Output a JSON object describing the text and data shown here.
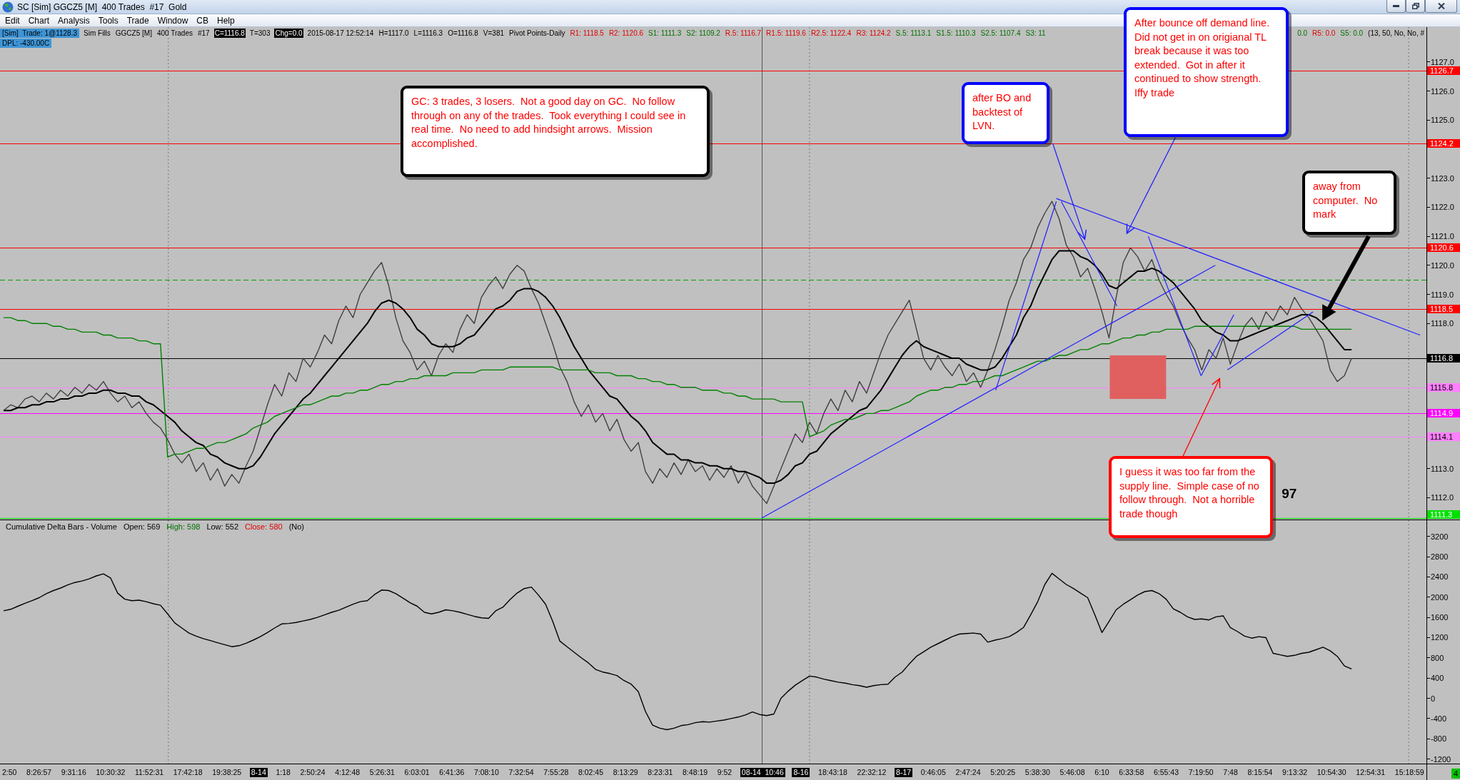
{
  "window": {
    "title": "SC [Sim] GGCZ5 [M]  400 Trades  #17  Gold"
  },
  "menu": [
    "Edit",
    "Chart",
    "Analysis",
    "Tools",
    "Trade",
    "Window",
    "CB",
    "Help"
  ],
  "price_pane": {
    "info_left": [
      {
        "text": "[Sim]  Trade: 1@1128.3",
        "kind": "highlight"
      },
      {
        "text": "Sim Fills",
        "kind": "plain"
      },
      {
        "text": "GGCZ5 [M]",
        "kind": "plain"
      },
      {
        "text": "400 Trades",
        "kind": "plain"
      },
      {
        "text": "#17",
        "kind": "plain"
      },
      {
        "text": "C=1116.8",
        "kind": "inverse"
      },
      {
        "text": "T=303",
        "kind": "plain"
      },
      {
        "text": "Chg=0.0",
        "kind": "inverse"
      },
      {
        "text": "2015-08-17 12:52:14",
        "kind": "plain"
      },
      {
        "text": "H=1117.0",
        "kind": "plain"
      },
      {
        "text": "L=1116.3",
        "kind": "plain"
      },
      {
        "text": "O=1116.8",
        "kind": "plain"
      },
      {
        "text": "V=381",
        "kind": "plain"
      },
      {
        "text": "Pivot Points-Daily",
        "kind": "plain"
      },
      {
        "text": "R1: 1118.5",
        "kind": "resistance"
      },
      {
        "text": "R2: 1120.6",
        "kind": "resistance"
      },
      {
        "text": "S1: 1111.3",
        "kind": "support"
      },
      {
        "text": "S2: 1109.2",
        "kind": "support"
      },
      {
        "text": "R.5: 1116.7",
        "kind": "resistance"
      },
      {
        "text": "R1.5: 1119.6",
        "kind": "resistance"
      },
      {
        "text": "R2.5: 1122.4",
        "kind": "resistance"
      },
      {
        "text": "R3: 1124.2",
        "kind": "resistance"
      },
      {
        "text": "S.5: 1113.1",
        "kind": "support"
      },
      {
        "text": "S1.5: 1110.3",
        "kind": "support"
      },
      {
        "text": "S2.5: 1107.4",
        "kind": "support"
      },
      {
        "text": "S3: 11",
        "kind": "support"
      }
    ],
    "info_right": [
      {
        "text": "0.0",
        "kind": "support"
      },
      {
        "text": "R5: 0.0",
        "kind": "resistance"
      },
      {
        "text": "S5: 0.0",
        "kind": "support"
      },
      {
        "text": "(13, 50, No, No, #",
        "kind": "plain"
      }
    ],
    "info_second_row": [
      {
        "text": "DPL: -430.00C",
        "kind": "highlight"
      }
    ],
    "chart_data": {
      "type": "line",
      "ylim": [
        1111.25,
        1128.2
      ],
      "yticks": [
        {
          "value": 1127,
          "label": "1127.0"
        },
        {
          "value": 1126,
          "label": "1126.0"
        },
        {
          "value": 1125,
          "label": "1125.0"
        },
        {
          "value": 1123,
          "label": "1123.0"
        },
        {
          "value": 1122,
          "label": "1122.0"
        },
        {
          "value": 1121,
          "label": "1121.0"
        },
        {
          "value": 1120,
          "label": "1120.0"
        },
        {
          "value": 1119,
          "label": "1119.0"
        },
        {
          "value": 1118,
          "label": "1118.0"
        },
        {
          "value": 1113,
          "label": "1113.0"
        },
        {
          "value": 1112,
          "label": "1112.0"
        }
      ],
      "series": [
        {
          "color": "#404040",
          "values": [
            1115.0,
            1115.2,
            1115.1,
            1115.4,
            1115.5,
            1115.3,
            1115.6,
            1115.4,
            1115.7,
            1115.5,
            1115.8,
            1115.6,
            1115.9,
            1115.7,
            1116.0,
            1115.6,
            1115.3,
            1115.5,
            1115.1,
            1115.3,
            1114.9,
            1114.6,
            1114.4,
            1114.0,
            1113.5,
            1113.2,
            1113.5,
            1112.9,
            1113.2,
            1112.6,
            1113.0,
            1112.4,
            1112.8,
            1112.5,
            1113.1,
            1113.6,
            1114.4,
            1115.2,
            1115.9,
            1115.5,
            1116.3,
            1116.0,
            1116.8,
            1116.5,
            1117.0,
            1117.6,
            1117.3,
            1118.1,
            1118.6,
            1118.2,
            1119.0,
            1119.4,
            1119.8,
            1120.1,
            1119.3,
            1118.2,
            1117.4,
            1117.0,
            1116.4,
            1116.7,
            1116.2,
            1116.9,
            1117.3,
            1117.0,
            1117.8,
            1118.3,
            1118.0,
            1118.9,
            1119.3,
            1119.6,
            1119.2,
            1119.7,
            1120.0,
            1119.8,
            1119.2,
            1118.7,
            1118.0,
            1117.3,
            1116.5,
            1116.0,
            1115.3,
            1114.8,
            1115.2,
            1114.6,
            1114.9,
            1114.3,
            1114.7,
            1114.0,
            1113.6,
            1113.9,
            1112.9,
            1112.5,
            1113.0,
            1112.7,
            1113.2,
            1112.8,
            1113.3,
            1112.9,
            1113.1,
            1112.6,
            1113.0,
            1112.7,
            1113.1,
            1112.5,
            1112.9,
            1112.4,
            1112.1,
            1111.8,
            1112.4,
            1113.0,
            1113.6,
            1114.2,
            1113.9,
            1114.6,
            1114.2,
            1114.9,
            1115.4,
            1115.0,
            1115.7,
            1115.3,
            1116.0,
            1115.6,
            1116.3,
            1117.0,
            1117.6,
            1118.0,
            1118.4,
            1118.8,
            1117.8,
            1116.8,
            1116.4,
            1116.9,
            1116.5,
            1116.2,
            1116.6,
            1116.0,
            1116.3,
            1115.8,
            1116.4,
            1117.1,
            1117.9,
            1118.8,
            1119.4,
            1120.2,
            1120.6,
            1121.3,
            1121.8,
            1122.2,
            1121.6,
            1120.7,
            1120.3,
            1119.6,
            1119.9,
            1119.2,
            1118.4,
            1117.5,
            1118.9,
            1120.1,
            1120.6,
            1120.3,
            1119.8,
            1120.2,
            1119.5,
            1119.0,
            1118.6,
            1118.0,
            1117.5,
            1117.1,
            1116.4,
            1117.1,
            1116.8,
            1117.5,
            1116.6,
            1117.3,
            1117.9,
            1118.2,
            1117.8,
            1118.4,
            1118.1,
            1118.6,
            1118.3,
            1118.9,
            1118.5,
            1118.2,
            1117.8,
            1117.4,
            1116.4,
            1116.0,
            1116.2,
            1116.8,
            null,
            null,
            null,
            null,
            null,
            null,
            null,
            null,
            null,
            null
          ]
        },
        {
          "color": "#000000",
          "values": [
            1115.0,
            1115.0,
            1115.1,
            1115.1,
            1115.2,
            1115.2,
            1115.3,
            1115.3,
            1115.4,
            1115.4,
            1115.5,
            1115.5,
            1115.6,
            1115.6,
            1115.7,
            1115.7,
            1115.6,
            1115.6,
            1115.5,
            1115.5,
            1115.3,
            1115.2,
            1115.0,
            1114.8,
            1114.6,
            1114.3,
            1114.1,
            1113.9,
            1113.8,
            1113.5,
            1113.4,
            1113.2,
            1113.1,
            1113.0,
            1113.0,
            1113.1,
            1113.4,
            1113.8,
            1114.2,
            1114.5,
            1114.8,
            1115.1,
            1115.4,
            1115.6,
            1115.9,
            1116.2,
            1116.5,
            1116.8,
            1117.1,
            1117.4,
            1117.7,
            1118.0,
            1118.4,
            1118.7,
            1118.8,
            1118.7,
            1118.5,
            1118.2,
            1117.8,
            1117.6,
            1117.3,
            1117.2,
            1117.2,
            1117.2,
            1117.3,
            1117.5,
            1117.6,
            1117.9,
            1118.2,
            1118.5,
            1118.6,
            1118.8,
            1119.1,
            1119.2,
            1119.2,
            1119.1,
            1118.9,
            1118.6,
            1118.2,
            1117.7,
            1117.2,
            1116.8,
            1116.4,
            1116.1,
            1115.8,
            1115.5,
            1115.4,
            1115.1,
            1114.8,
            1114.6,
            1114.3,
            1113.9,
            1113.7,
            1113.5,
            1113.5,
            1113.3,
            1113.3,
            1113.2,
            1113.2,
            1113.1,
            1113.1,
            1113.0,
            1113.0,
            1112.9,
            1112.9,
            1112.8,
            1112.7,
            1112.5,
            1112.5,
            1112.6,
            1112.8,
            1113.1,
            1113.2,
            1113.5,
            1113.6,
            1113.9,
            1114.2,
            1114.4,
            1114.6,
            1114.8,
            1115.0,
            1115.1,
            1115.4,
            1115.7,
            1116.1,
            1116.5,
            1116.9,
            1117.2,
            1117.4,
            1117.2,
            1117.1,
            1117.0,
            1116.9,
            1116.8,
            1116.8,
            1116.6,
            1116.5,
            1116.4,
            1116.4,
            1116.5,
            1116.8,
            1117.2,
            1117.6,
            1118.2,
            1118.6,
            1119.2,
            1119.7,
            1120.2,
            1120.5,
            1120.5,
            1120.5,
            1120.3,
            1120.2,
            1120.0,
            1119.7,
            1119.3,
            1119.2,
            1119.4,
            1119.6,
            1119.8,
            1119.8,
            1119.9,
            1119.8,
            1119.6,
            1119.4,
            1119.1,
            1118.8,
            1118.5,
            1118.1,
            1117.9,
            1117.7,
            1117.6,
            1117.4,
            1117.4,
            1117.5,
            1117.6,
            1117.7,
            1117.8,
            1117.9,
            1118.0,
            1118.1,
            1118.2,
            1118.3,
            1118.3,
            1118.2,
            1118.0,
            1117.7,
            1117.4,
            1117.1,
            1117.1,
            null,
            null,
            null,
            null,
            null,
            null,
            null,
            null,
            null,
            null
          ]
        },
        {
          "color": "#008000",
          "values": [
            1118.2,
            1118.2,
            1118.1,
            1118.1,
            1118.0,
            1118.0,
            1118.0,
            1117.9,
            1117.9,
            1117.8,
            1117.8,
            1117.7,
            1117.7,
            1117.7,
            1117.6,
            1117.6,
            1117.5,
            1117.5,
            1117.5,
            1117.4,
            1117.4,
            1117.3,
            1117.3,
            1113.4,
            1113.5,
            1113.5,
            1113.6,
            1113.7,
            1113.7,
            1113.8,
            1113.9,
            1113.9,
            1114.0,
            1114.1,
            1114.2,
            1114.4,
            1114.5,
            1114.6,
            1114.8,
            1114.9,
            1115.0,
            1115.1,
            1115.2,
            1115.2,
            1115.3,
            1115.4,
            1115.5,
            1115.5,
            1115.6,
            1115.6,
            1115.7,
            1115.7,
            1115.8,
            1115.9,
            1115.9,
            1116.0,
            1116.0,
            1116.1,
            1116.1,
            1116.2,
            1116.2,
            1116.2,
            1116.2,
            1116.3,
            1116.3,
            1116.3,
            1116.3,
            1116.4,
            1116.4,
            1116.4,
            1116.4,
            1116.5,
            1116.5,
            1116.5,
            1116.5,
            1116.5,
            1116.5,
            1116.5,
            1116.4,
            1116.4,
            1116.4,
            1116.4,
            1116.4,
            1116.3,
            1116.3,
            1116.3,
            1116.2,
            1116.2,
            1116.2,
            1116.1,
            1116.1,
            1116.0,
            1116.0,
            1115.9,
            1115.9,
            1115.8,
            1115.8,
            1115.8,
            1115.7,
            1115.7,
            1115.7,
            1115.6,
            1115.6,
            1115.5,
            1115.5,
            1115.4,
            1115.4,
            1115.4,
            1115.4,
            1115.3,
            1115.3,
            1115.3,
            1115.3,
            1114.1,
            1114.2,
            1114.3,
            1114.5,
            1114.6,
            1114.7,
            1114.7,
            1114.8,
            1114.9,
            1114.9,
            1115.0,
            1115.0,
            1115.1,
            1115.2,
            1115.3,
            1115.5,
            1115.6,
            1115.7,
            1115.7,
            1115.8,
            1115.8,
            1115.9,
            1115.9,
            1116.0,
            1116.0,
            1116.1,
            1116.2,
            1116.2,
            1116.3,
            1116.4,
            1116.5,
            1116.6,
            1116.7,
            1116.7,
            1116.8,
            1116.9,
            1116.9,
            1117.0,
            1117.1,
            1117.1,
            1117.2,
            1117.3,
            1117.3,
            1117.4,
            1117.5,
            1117.5,
            1117.6,
            1117.6,
            1117.7,
            1117.7,
            1117.8,
            1117.8,
            1117.8,
            1117.8,
            1117.9,
            1117.9,
            1117.9,
            1117.9,
            1117.9,
            1117.9,
            1117.9,
            1117.9,
            1117.9,
            1117.9,
            1117.9,
            1117.9,
            1117.9,
            1117.9,
            1117.9,
            1117.8,
            1117.8,
            1117.8,
            1117.8,
            1117.8,
            1117.8,
            1117.8,
            1117.8,
            null,
            null,
            null,
            null,
            null,
            null,
            null,
            null,
            null,
            null
          ]
        }
      ],
      "ref_lines": [
        {
          "axis": "y",
          "value": 1126.7,
          "label": "1126.7",
          "color": "#ff0000"
        },
        {
          "axis": "y",
          "value": 1124.2,
          "label": "1124.2",
          "color": "#ff0000"
        },
        {
          "axis": "y",
          "value": 1120.6,
          "label": "1120.6",
          "color": "#ff0000"
        },
        {
          "axis": "y",
          "value": 1119.5,
          "color": "#00a000"
        },
        {
          "axis": "y",
          "value": 1118.5,
          "label": "1118.5",
          "color": "#ff0000"
        },
        {
          "axis": "y",
          "value": 1116.8,
          "label": "1116.8",
          "color": "#000000"
        },
        {
          "axis": "y",
          "value": 1115.8,
          "label": "1115.8",
          "color": "#ff80ff"
        },
        {
          "axis": "y",
          "value": 1114.9,
          "label": "1114.9",
          "color": "#ff00ff"
        },
        {
          "axis": "y",
          "value": 1114.1,
          "label": "1114.1",
          "color": "#ff80ff"
        },
        {
          "axis": "y",
          "value": 1111.3,
          "label": "1111.3",
          "color": "#00e000"
        }
      ],
      "annotations": [
        "97"
      ]
    }
  },
  "delta_pane": {
    "legend": [
      {
        "text": "Cumulative Delta Bars - Volume",
        "kind": "plain"
      },
      {
        "text": "Open: 569",
        "kind": "plain"
      },
      {
        "text": "High: 598",
        "kind": "high"
      },
      {
        "text": "Low: 552",
        "kind": "plain"
      },
      {
        "text": "Close: 580",
        "kind": "close"
      },
      {
        "text": "(No)",
        "kind": "plain"
      }
    ],
    "chart_data": {
      "type": "line",
      "ylim": [
        -1290,
        3520
      ],
      "yticks": [
        3200,
        2800,
        2400,
        2000,
        1600,
        1200,
        800,
        400,
        0,
        -400,
        -800,
        -1200
      ],
      "series": [
        {
          "color": "#000000",
          "values": [
            1730,
            1760,
            1820,
            1880,
            1930,
            1990,
            2070,
            2130,
            2180,
            2240,
            2290,
            2320,
            2360,
            2420,
            2460,
            2380,
            2080,
            1960,
            1930,
            1940,
            1910,
            1870,
            1840,
            1670,
            1490,
            1390,
            1290,
            1230,
            1180,
            1140,
            1100,
            1060,
            1020,
            1040,
            1090,
            1150,
            1220,
            1300,
            1390,
            1470,
            1480,
            1500,
            1530,
            1560,
            1600,
            1650,
            1700,
            1740,
            1800,
            1860,
            1910,
            1930,
            2050,
            2140,
            2130,
            2070,
            1980,
            1890,
            1820,
            1700,
            1670,
            1700,
            1750,
            1730,
            1700,
            1660,
            1620,
            1590,
            1580,
            1730,
            1800,
            1950,
            2080,
            2170,
            2200,
            2040,
            1860,
            1520,
            1130,
            1020,
            910,
            800,
            700,
            570,
            520,
            490,
            450,
            350,
            280,
            130,
            -260,
            -530,
            -590,
            -620,
            -590,
            -540,
            -520,
            -480,
            -460,
            -470,
            -450,
            -430,
            -400,
            -370,
            -330,
            -270,
            -320,
            -340,
            -310,
            0,
            140,
            260,
            350,
            440,
            420,
            380,
            350,
            320,
            300,
            270,
            250,
            220,
            250,
            270,
            280,
            420,
            520,
            680,
            830,
            920,
            1010,
            1080,
            1150,
            1220,
            1270,
            1280,
            1290,
            1270,
            1110,
            1150,
            1180,
            1220,
            1300,
            1400,
            1650,
            1910,
            2250,
            2470,
            2360,
            2250,
            2170,
            2080,
            1990,
            1650,
            1300,
            1520,
            1750,
            1860,
            1950,
            2040,
            2110,
            2130,
            2070,
            1960,
            1770,
            1700,
            1610,
            1560,
            1570,
            1550,
            1610,
            1630,
            1400,
            1320,
            1230,
            1190,
            1220,
            1200,
            890,
            860,
            830,
            850,
            890,
            910,
            960,
            1010,
            940,
            830,
            640,
            580,
            null,
            null,
            null,
            null,
            null,
            null,
            null,
            null,
            null,
            null
          ]
        }
      ]
    }
  },
  "time_axis": [
    {
      "label": "2:50",
      "kind": "time"
    },
    {
      "label": "8:26:57",
      "kind": "time"
    },
    {
      "label": "9:31:16",
      "kind": "time"
    },
    {
      "label": "10:30:32",
      "kind": "time"
    },
    {
      "label": "11:52:31",
      "kind": "time"
    },
    {
      "label": "17:42:18",
      "kind": "time"
    },
    {
      "label": "19:38:25",
      "kind": "time"
    },
    {
      "label": "8-14",
      "kind": "date"
    },
    {
      "label": "1:18",
      "kind": "time"
    },
    {
      "label": "2:50:24",
      "kind": "time"
    },
    {
      "label": "4:12:48",
      "kind": "time"
    },
    {
      "label": "5:26:31",
      "kind": "time"
    },
    {
      "label": "6:03:01",
      "kind": "time"
    },
    {
      "label": "6:41:36",
      "kind": "time"
    },
    {
      "label": "7:08:10",
      "kind": "time"
    },
    {
      "label": "7:32:54",
      "kind": "time"
    },
    {
      "label": "7:55:28",
      "kind": "time"
    },
    {
      "label": "8:02:45",
      "kind": "time"
    },
    {
      "label": "8:13:29",
      "kind": "time"
    },
    {
      "label": "8:23:31",
      "kind": "time"
    },
    {
      "label": "8:48:19",
      "kind": "time"
    },
    {
      "label": "9:52",
      "kind": "time"
    },
    {
      "label": "08-14  10:46",
      "kind": "cursor"
    },
    {
      "label": "8-16",
      "kind": "date"
    },
    {
      "label": "18:43:18",
      "kind": "time"
    },
    {
      "label": "22:32:12",
      "kind": "time"
    },
    {
      "label": "8-17",
      "kind": "date"
    },
    {
      "label": "0:46:05",
      "kind": "time"
    },
    {
      "label": "2:47:24",
      "kind": "time"
    },
    {
      "label": "5:20:25",
      "kind": "time"
    },
    {
      "label": "5:38:30",
      "kind": "time"
    },
    {
      "label": "5:46:08",
      "kind": "time"
    },
    {
      "label": "6:10",
      "kind": "time"
    },
    {
      "label": "6:33:58",
      "kind": "time"
    },
    {
      "label": "6:55:43",
      "kind": "time"
    },
    {
      "label": "7:19:50",
      "kind": "time"
    },
    {
      "label": "7:48",
      "kind": "time"
    },
    {
      "label": "8:15:54",
      "kind": "time"
    },
    {
      "label": "9:13:32",
      "kind": "time"
    },
    {
      "label": "10:54:30",
      "kind": "time"
    },
    {
      "label": "12:54:31",
      "kind": "time"
    },
    {
      "label": "15:18:59",
      "kind": "time"
    }
  ],
  "axis_badge": "4",
  "notes": [
    {
      "text": "GC: 3 trades, 3 losers.  Not a good day on GC.  No follow through on any of the trades.  Took everything I could see in real time.  No need to add hindsight arrows.  Mission accomplished.",
      "color": "#000000"
    },
    {
      "text": "after BO and backtest of LVN.",
      "color": "#0000ff"
    },
    {
      "text": "After bounce off demand line.  Did not get in on origianal TL break because it was too extended.  Got in after it continued to show strength.  Iffy trade",
      "color": "#0000ff"
    },
    {
      "text": "away from computer.  No mark",
      "color": "#000000"
    },
    {
      "text": "I guess it was too far from the supply line.  Simple case of no follow through.  Not a horrible trade though",
      "color": "#ff0000"
    }
  ]
}
